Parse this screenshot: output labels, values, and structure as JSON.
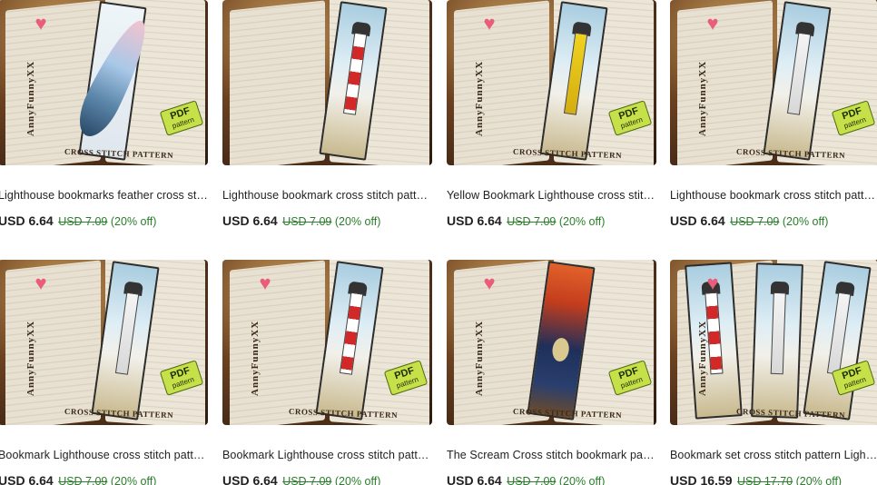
{
  "listings": [
    {
      "title": "Lighthouse bookmarks feather cross stitch pattern",
      "price": "USD 6.64",
      "original_price": "USD 7.09",
      "discount": "(20% off)",
      "brand": "AnnyFunnyXX",
      "caption": "CROSS STITCH PATTERN",
      "tag_pdf": "PDF",
      "tag_pattern": "pattern",
      "artwork": "feather"
    },
    {
      "title": "Lighthouse bookmark cross stitch pattern",
      "price": "USD 6.64",
      "original_price": "USD 7.09",
      "discount": "(20% off)",
      "brand": "",
      "caption": "",
      "tag_pdf": "",
      "tag_pattern": "",
      "artwork": "lighthouse-red"
    },
    {
      "title": "Yellow Bookmark Lighthouse cross stitch pattern",
      "price": "USD 6.64",
      "original_price": "USD 7.09",
      "discount": "(20% off)",
      "brand": "AnnyFunnyXX",
      "caption": "CROSS STITCH PATTERN",
      "tag_pdf": "PDF",
      "tag_pattern": "pattern",
      "artwork": "lighthouse-yellow"
    },
    {
      "title": "Lighthouse bookmark cross stitch pattern",
      "price": "USD 6.64",
      "original_price": "USD 7.09",
      "discount": "(20% off)",
      "brand": "AnnyFunnyXX",
      "caption": "CROSS STITCH PATTERN",
      "tag_pdf": "PDF",
      "tag_pattern": "pattern",
      "artwork": "lighthouse-white"
    },
    {
      "title": "Bookmark Lighthouse cross stitch pattern",
      "price": "USD 6.64",
      "original_price": "USD 7.09",
      "discount": "(20% off)",
      "brand": "AnnyFunnyXX",
      "caption": "CROSS STITCH PATTERN",
      "tag_pdf": "PDF",
      "tag_pattern": "pattern",
      "artwork": "lighthouse-white"
    },
    {
      "title": "Bookmark Lighthouse cross stitch pattern",
      "price": "USD 6.64",
      "original_price": "USD 7.09",
      "discount": "(20% off)",
      "brand": "AnnyFunnyXX",
      "caption": "CROSS STITCH PATTERN",
      "tag_pdf": "PDF",
      "tag_pattern": "pattern",
      "artwork": "lighthouse-red"
    },
    {
      "title": "The Scream Cross stitch bookmark pattern",
      "price": "USD 6.64",
      "original_price": "USD 7.09",
      "discount": "(20% off)",
      "brand": "AnnyFunnyXX",
      "caption": "CROSS STITCH PATTERN",
      "tag_pdf": "PDF",
      "tag_pattern": "pattern",
      "artwork": "scream"
    },
    {
      "title": "Bookmark set cross stitch pattern Lighthouse",
      "price": "USD 16.59",
      "original_price": "USD 17.70",
      "discount": "(20% off)",
      "brand": "AnnyFunnyXX",
      "caption": "CROSS STITCH PATTERN",
      "tag_pdf": "PDF",
      "tag_pattern": "pattern",
      "artwork": "set"
    }
  ],
  "colors": {
    "discount_green": "#2a7d2a",
    "pdf_tag": "#c6e04a",
    "heart": "#e95d7b"
  }
}
